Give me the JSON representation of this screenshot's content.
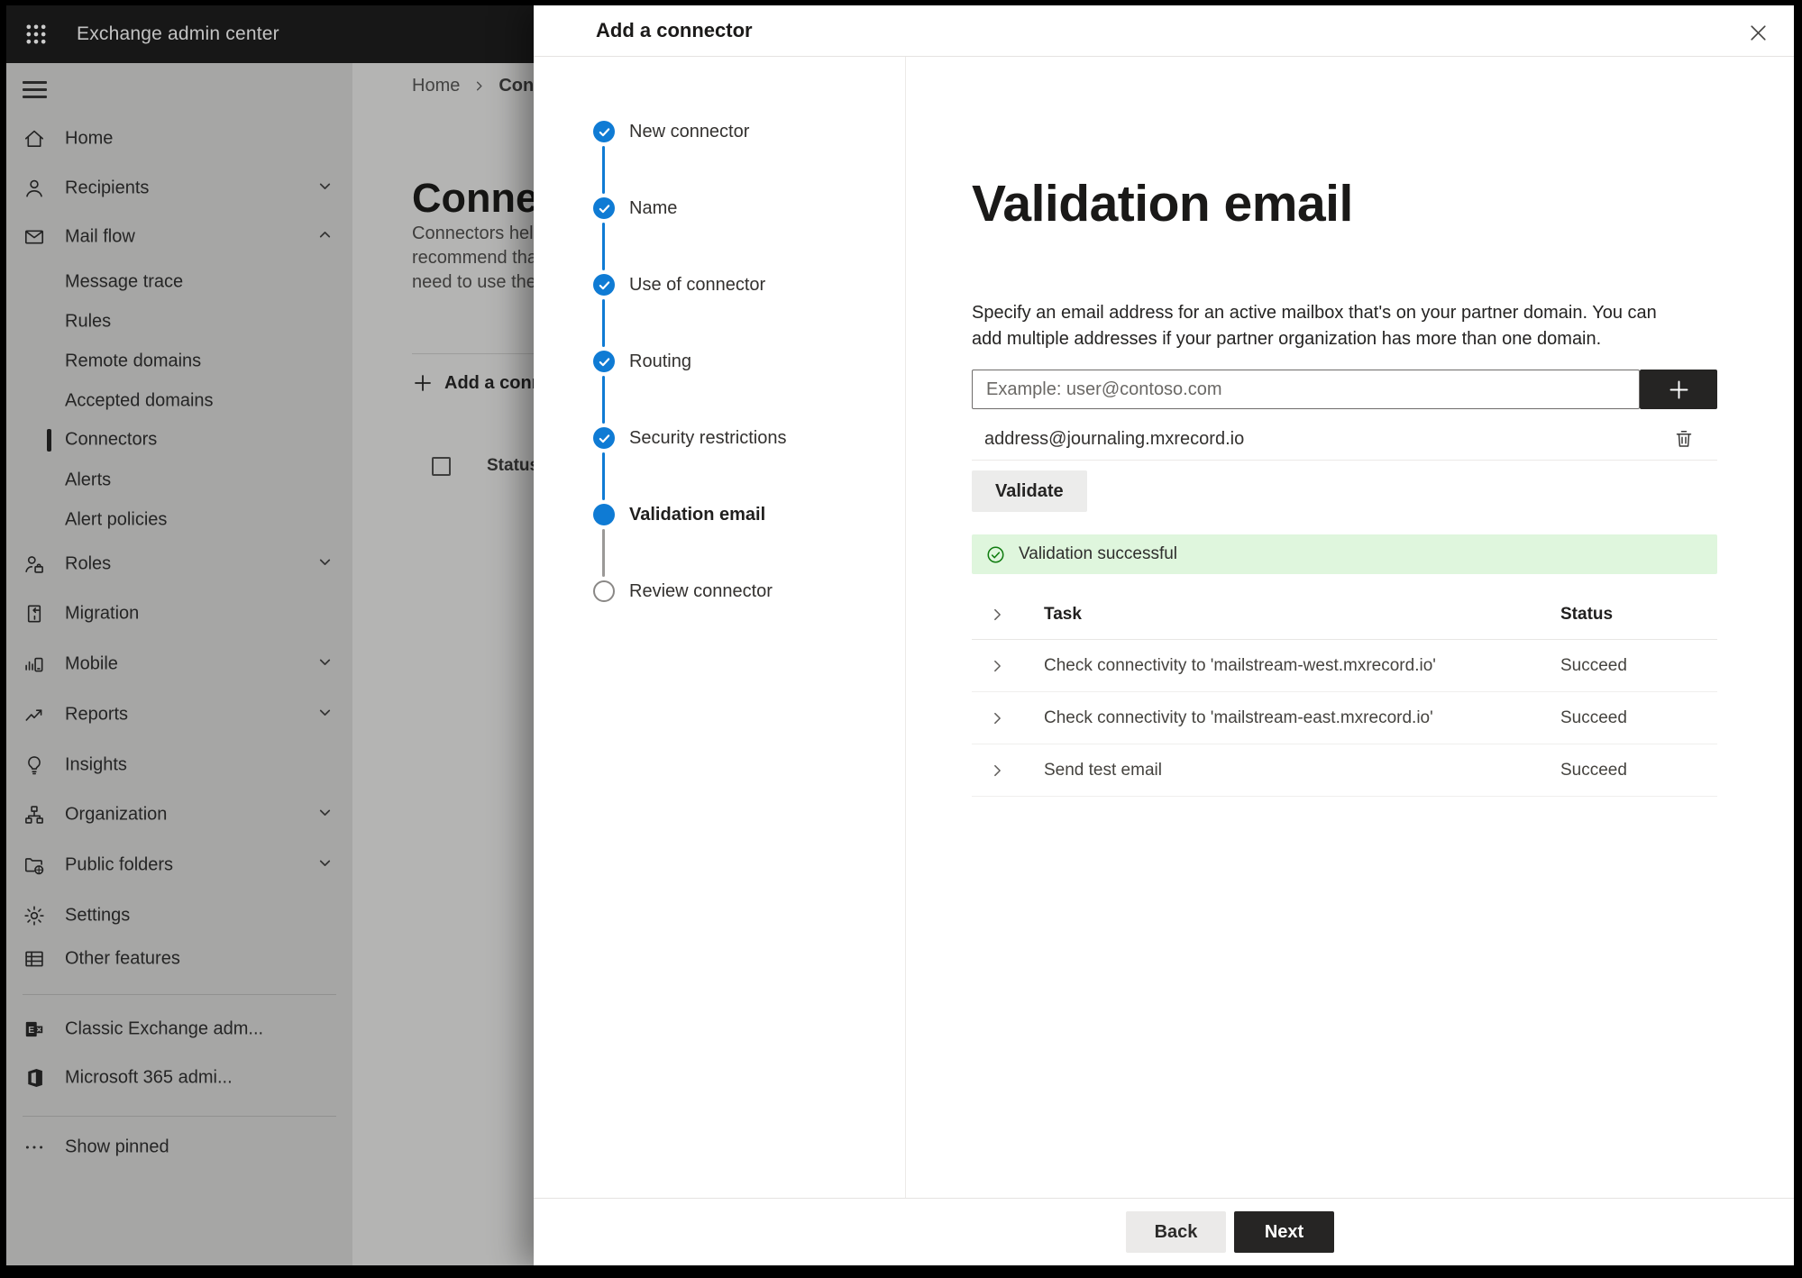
{
  "app_bar": {
    "title": "Exchange admin center"
  },
  "sidebar": {
    "items": [
      {
        "label": "Home",
        "icon": "home-icon"
      },
      {
        "label": "Recipients",
        "icon": "person-icon",
        "chevron": "down"
      },
      {
        "label": "Mail flow",
        "icon": "mail-icon",
        "chevron": "up"
      },
      {
        "label": "Message trace",
        "indent": true
      },
      {
        "label": "Rules",
        "indent": true
      },
      {
        "label": "Remote domains",
        "indent": true
      },
      {
        "label": "Accepted domains",
        "indent": true
      },
      {
        "label": "Connectors",
        "indent": true,
        "selected": true
      },
      {
        "label": "Alerts",
        "indent": true
      },
      {
        "label": "Alert policies",
        "indent": true
      },
      {
        "label": "Roles",
        "icon": "roles-icon",
        "chevron": "down"
      },
      {
        "label": "Migration",
        "icon": "migration-icon"
      },
      {
        "label": "Mobile",
        "icon": "mobile-icon",
        "chevron": "down"
      },
      {
        "label": "Reports",
        "icon": "reports-icon",
        "chevron": "down"
      },
      {
        "label": "Insights",
        "icon": "insights-icon"
      },
      {
        "label": "Organization",
        "icon": "organization-icon",
        "chevron": "down"
      },
      {
        "label": "Public folders",
        "icon": "public-folders-icon",
        "chevron": "down"
      },
      {
        "label": "Settings",
        "icon": "settings-icon"
      },
      {
        "label": "Other features",
        "icon": "other-features-icon"
      },
      {
        "label": "Classic Exchange adm...",
        "icon": "exchange-logo-icon"
      },
      {
        "label": "Microsoft 365 admi...",
        "icon": "microsoft-365-icon"
      },
      {
        "label": "Show pinned",
        "icon": "more-dots-icon"
      }
    ]
  },
  "page": {
    "breadcrumb": {
      "home": "Home",
      "current": "Conne"
    },
    "heading": "Connec",
    "intro_lines": [
      "Connectors help",
      "recommend that",
      "need to use the"
    ],
    "add_button": "Add a conn",
    "status_header": "Status"
  },
  "panel": {
    "title": "Add a connector",
    "steps": [
      {
        "label": "New connector",
        "state": "complete"
      },
      {
        "label": "Name",
        "state": "complete"
      },
      {
        "label": "Use of connector",
        "state": "complete"
      },
      {
        "label": "Routing",
        "state": "complete"
      },
      {
        "label": "Security restrictions",
        "state": "complete"
      },
      {
        "label": "Validation email",
        "state": "current"
      },
      {
        "label": "Review connector",
        "state": "upcoming"
      }
    ],
    "content": {
      "heading": "Validation email",
      "description": "Specify an email address for an active mailbox that's on your partner domain. You can add multiple addresses if your partner organization has more than one domain.",
      "email_input_placeholder": "Example: user@contoso.com",
      "added_address": "address@journaling.mxrecord.io",
      "validate_button": "Validate",
      "success_message": "Validation successful",
      "table": {
        "headers": [
          "Task",
          "Status"
        ],
        "rows": [
          {
            "task": "Check connectivity to 'mailstream-west.mxrecord.io'",
            "status": "Succeed"
          },
          {
            "task": "Check connectivity to 'mailstream-east.mxrecord.io'",
            "status": "Succeed"
          },
          {
            "task": "Send test email",
            "status": "Succeed"
          }
        ]
      }
    },
    "footer": {
      "back": "Back",
      "next": "Next"
    }
  },
  "colors": {
    "accent": "#0f7bd4",
    "success_bg": "#dff6dd",
    "success_icon": "#107c10",
    "primary_button": "#262524"
  }
}
